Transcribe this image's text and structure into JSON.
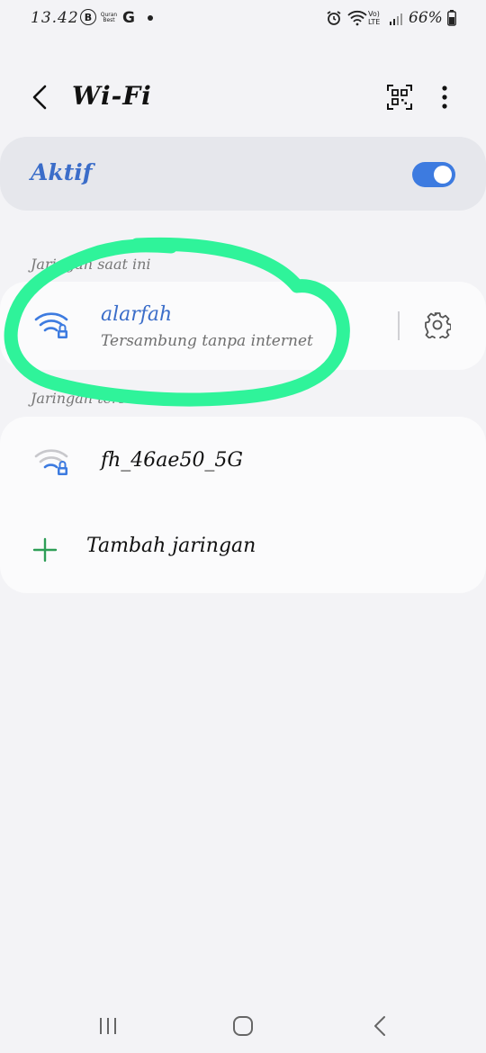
{
  "status_bar": {
    "time": "13.42",
    "b_icon_letter": "B",
    "quran_line1": "Quran",
    "quran_line2": "Best",
    "g_letter": "G",
    "network": "Vo) LTE",
    "battery": "66%"
  },
  "appbar": {
    "title": "Wi-Fi",
    "icons": [
      "back-chevron-icon",
      "qr-code-icon",
      "more-vert-icon"
    ]
  },
  "wifi_toggle": {
    "label": "Aktif",
    "on": true,
    "accent": "#3d7be0"
  },
  "current_section": {
    "label": "Jaringan saat ini",
    "network": {
      "name": "alarfah",
      "status": "Tersambung tanpa internet",
      "color": "#3b6dc9"
    }
  },
  "available_section": {
    "label": "Jaringan tersedia",
    "networks": [
      {
        "name": "fh_46ae50_5G"
      }
    ],
    "add_label": "Tambah jaringan"
  },
  "annotation": {
    "color": "#2ff39a"
  }
}
